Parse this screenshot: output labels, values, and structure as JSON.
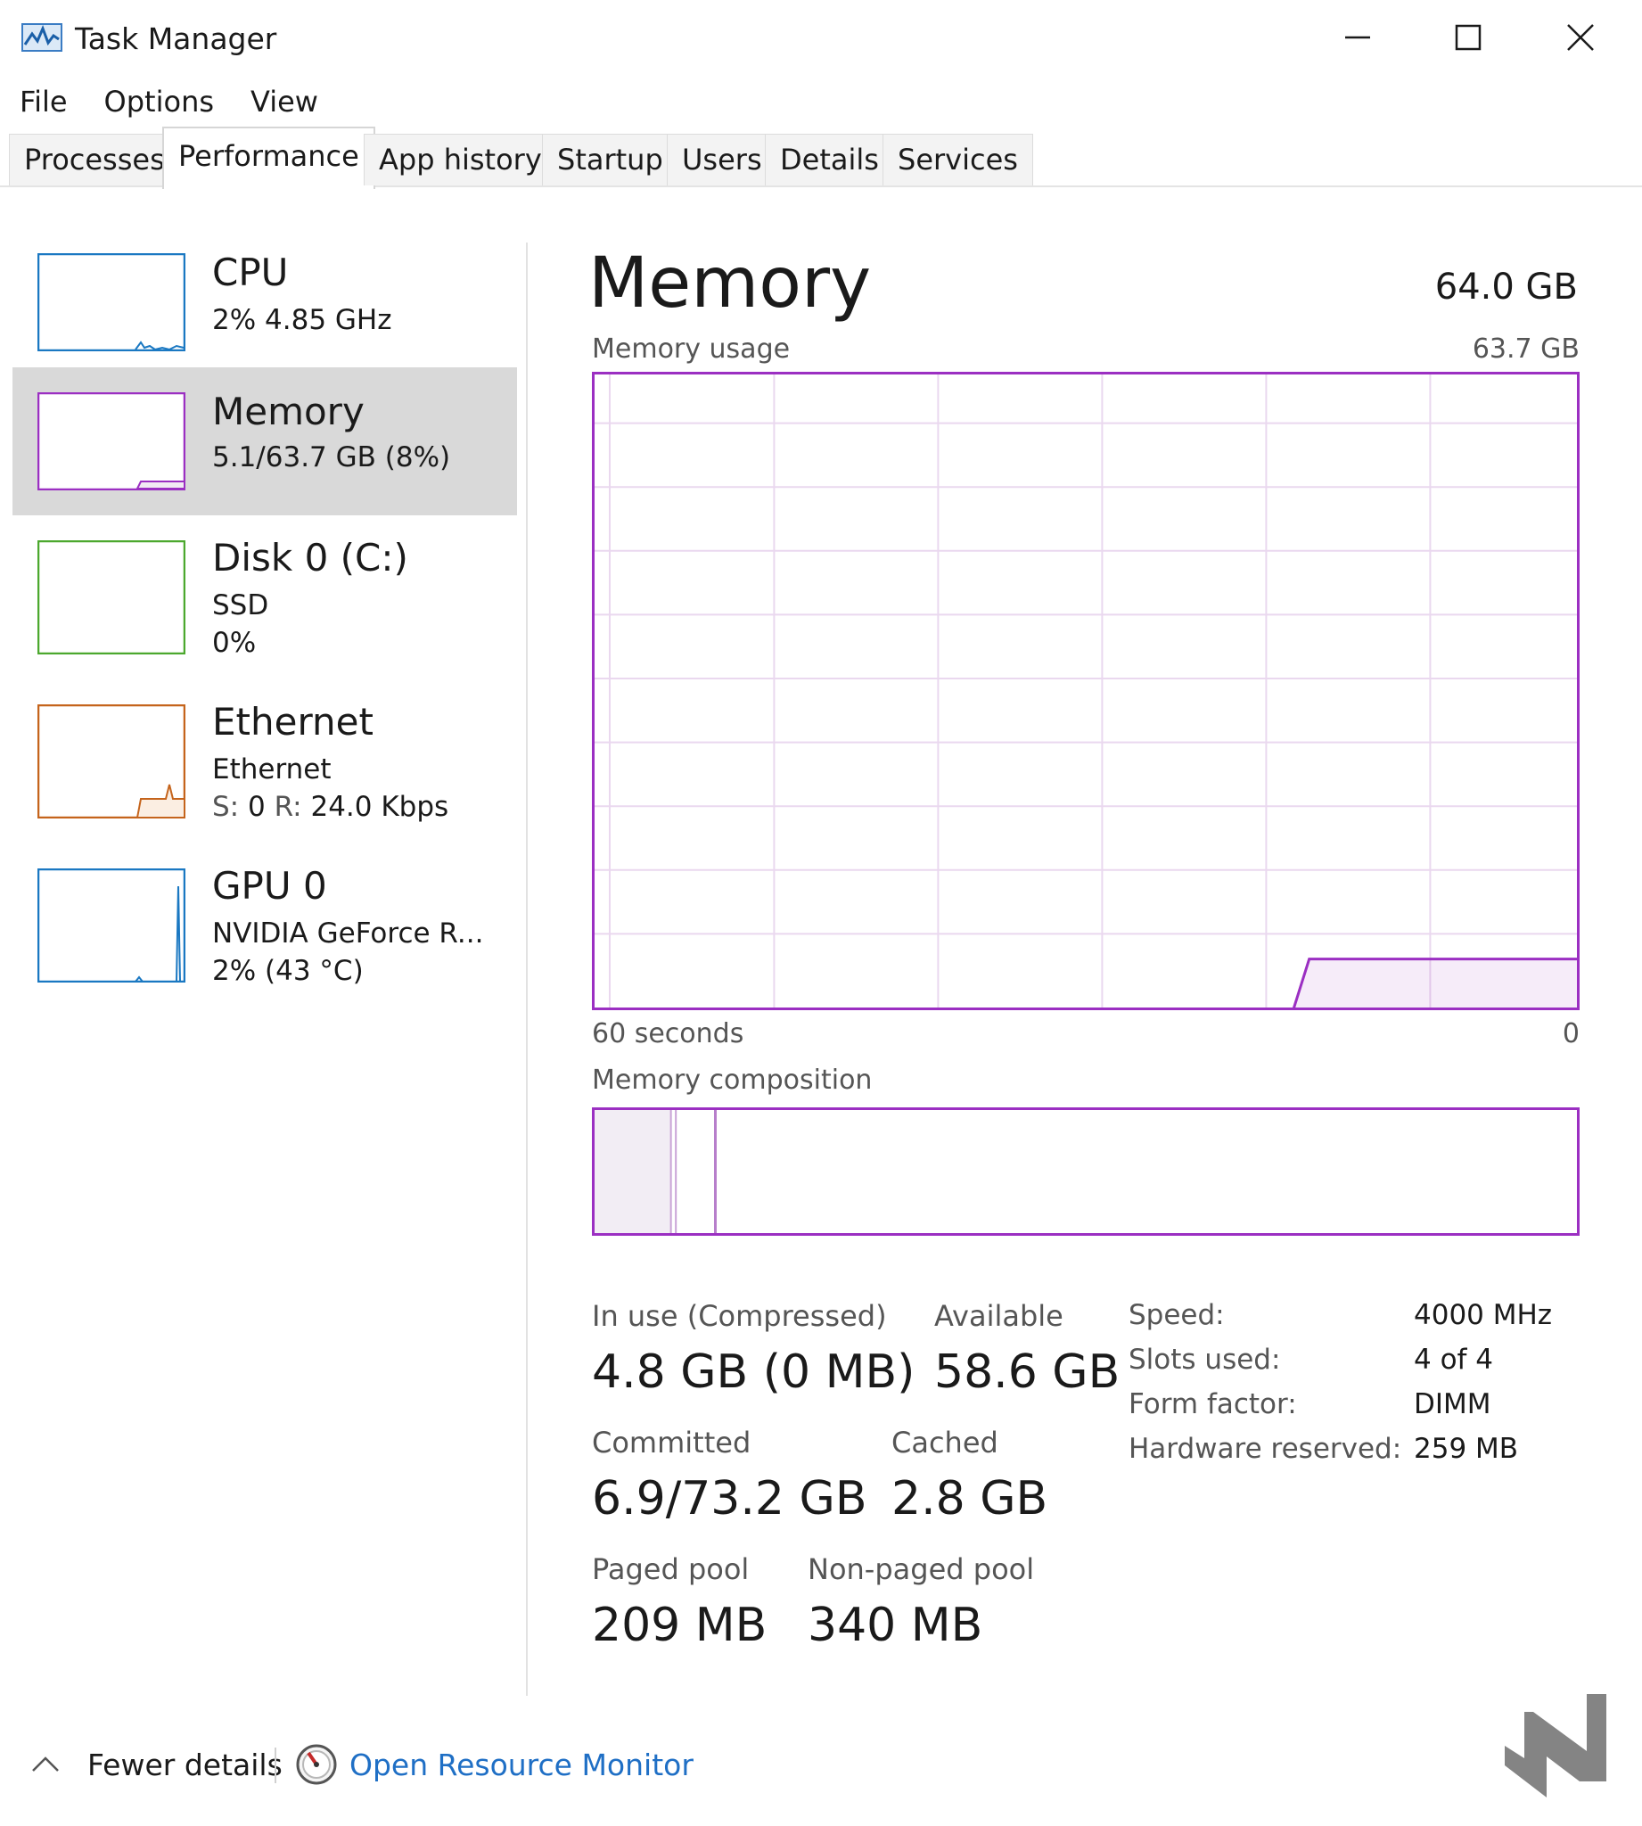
{
  "window": {
    "title": "Task Manager",
    "icon": "task-manager-icon",
    "controls": [
      "minimize-icon",
      "maximize-icon",
      "close-icon"
    ]
  },
  "menu": [
    "File",
    "Options",
    "View"
  ],
  "tabs": [
    {
      "label": "Processes",
      "active": false
    },
    {
      "label": "Performance",
      "active": true
    },
    {
      "label": "App history",
      "active": false
    },
    {
      "label": "Startup",
      "active": false
    },
    {
      "label": "Users",
      "active": false
    },
    {
      "label": "Details",
      "active": false
    },
    {
      "label": "Services",
      "active": false
    }
  ],
  "sidebar": [
    {
      "title": "CPU",
      "line1": "2%  4.85 GHz",
      "color": "#1a78c2",
      "selected": false
    },
    {
      "title": "Memory",
      "line1": "5.1/63.7 GB (8%)",
      "color": "#9b2fc2",
      "selected": true
    },
    {
      "title": "Disk 0 (C:)",
      "line1": "SSD",
      "line2": "0%",
      "color": "#4ca82e",
      "selected": false
    },
    {
      "title": "Ethernet",
      "line1": "Ethernet",
      "line2_label_s": "S:",
      "line2_val_s": "0",
      "line2_label_r": "R:",
      "line2_val_r": "24.0 Kbps",
      "color": "#c5641c",
      "selected": false
    },
    {
      "title": "GPU 0",
      "line1": "NVIDIA GeForce R...",
      "line2": "2%  (43 °C)",
      "color": "#1a78c2",
      "selected": false
    }
  ],
  "main": {
    "title": "Memory",
    "total": "64.0 GB",
    "usage_label": "Memory usage",
    "usage_max": "63.7 GB",
    "time_left": "60 seconds",
    "time_right": "0",
    "composition_label": "Memory composition",
    "accent": "#9b2fc2"
  },
  "chart_data": {
    "type": "area",
    "title": "Memory usage",
    "xlabel": "",
    "ylabel": "",
    "x_range_label": [
      "60 seconds",
      "0"
    ],
    "ylim": [
      0,
      63.7
    ],
    "y_unit": "GB",
    "grid": true,
    "segment": {
      "start_fraction": 0.71,
      "end_fraction": 1.0,
      "value": 5.1
    }
  },
  "composition": {
    "in_use_fraction": 0.08,
    "modified_fraction": 0.005,
    "standby_fraction": 0.04
  },
  "stats": {
    "in_use_label": "In use (Compressed)",
    "in_use_value": "4.8 GB (0 MB)",
    "available_label": "Available",
    "available_value": "58.6 GB",
    "committed_label": "Committed",
    "committed_value": "6.9/73.2 GB",
    "cached_label": "Cached",
    "cached_value": "2.8 GB",
    "paged_label": "Paged pool",
    "paged_value": "209 MB",
    "nonpaged_label": "Non-paged pool",
    "nonpaged_value": "340 MB"
  },
  "specs": [
    {
      "label": "Speed:",
      "value": "4000 MHz"
    },
    {
      "label": "Slots used:",
      "value": "4 of 4"
    },
    {
      "label": "Form factor:",
      "value": "DIMM"
    },
    {
      "label": "Hardware reserved:",
      "value": "259 MB"
    }
  ],
  "footer": {
    "fewer_details": "Fewer details",
    "resource_monitor": "Open Resource Monitor"
  }
}
